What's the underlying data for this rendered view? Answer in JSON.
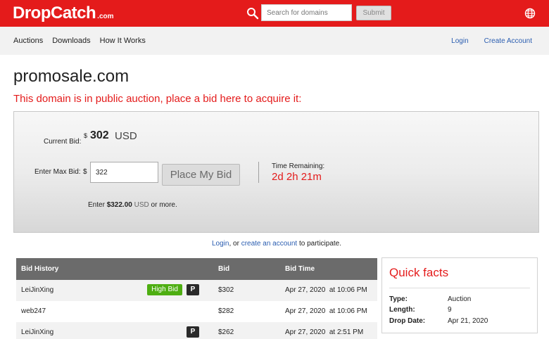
{
  "header": {
    "logo_main": "DropCatch",
    "logo_com": ".com",
    "search_placeholder": "Search for domains",
    "submit_label": "Submit"
  },
  "nav": {
    "left": [
      "Auctions",
      "Downloads",
      "How It Works"
    ],
    "login": "Login",
    "create_account": "Create Account"
  },
  "domain": {
    "name": "promosale.com",
    "auction_message": "This domain is in public auction, place a bid here to acquire it:"
  },
  "bid_panel": {
    "current_bid_label": "Current Bid:",
    "currency_symbol": "$",
    "current_bid_amount": "302",
    "current_bid_currency": "USD",
    "max_bid_label": "Enter Max Bid:",
    "max_bid_value": "322",
    "place_bid_label": "Place My Bid",
    "time_remaining_label": "Time Remaining:",
    "time_remaining_value": "2d 2h 21m",
    "enter_note_prefix": "Enter",
    "enter_note_amount": "$322.00",
    "enter_note_currency": "USD",
    "enter_note_suffix": "or more."
  },
  "login_prompt": {
    "login": "Login",
    "or": ", or ",
    "create": "create an account",
    "suffix": " to participate."
  },
  "bid_history": {
    "headers": [
      "Bid History",
      "Bid",
      "Bid Time"
    ],
    "rows": [
      {
        "bidder": "LeiJinXing",
        "high_bid": "High Bid",
        "private": "P",
        "bid": "$302",
        "time": "Apr 27, 2020  at 10:06 PM"
      },
      {
        "bidder": "web247",
        "high_bid": "",
        "private": "",
        "bid": "$282",
        "time": "Apr 27, 2020  at 10:06 PM"
      },
      {
        "bidder": "LeiJinXing",
        "high_bid": "",
        "private": "P",
        "bid": "$262",
        "time": "Apr 27, 2020  at 2:51 PM"
      }
    ]
  },
  "quick_facts": {
    "title": "Quick facts",
    "rows": [
      {
        "label": "Type:",
        "value": "Auction"
      },
      {
        "label": "Length:",
        "value": "9"
      },
      {
        "label": "Drop Date:",
        "value": "Apr 21, 2020"
      }
    ]
  },
  "colors": {
    "brand_red": "#e41b1b",
    "link_blue": "#2a5db0",
    "high_bid_green": "#4eae12"
  }
}
